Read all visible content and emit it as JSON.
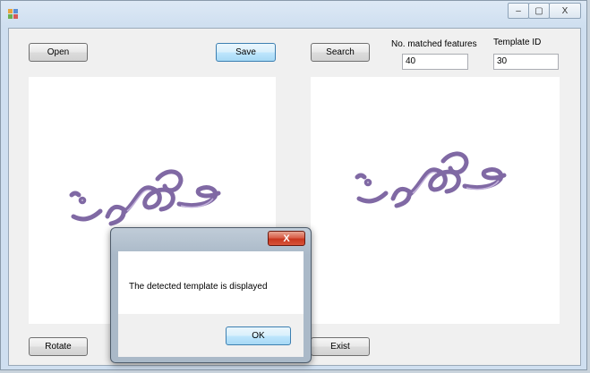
{
  "toolbar": {
    "open_label": "Open",
    "save_label": "Save",
    "search_label": "Search",
    "rotate_label": "Rotate",
    "exist_label": "Exist"
  },
  "fields": {
    "matched_label": "No. matched features",
    "matched_value": "40",
    "template_label": "Template ID",
    "template_value": "30"
  },
  "images": {
    "left_signature": "عکود",
    "right_signature": "عکود"
  },
  "dialog": {
    "message": "The detected template is displayed",
    "ok_label": "OK",
    "close_glyph": "X"
  },
  "window_controls": {
    "minimize_glyph": "–",
    "maximize_glyph": "▢",
    "close_glyph": "X"
  },
  "colors": {
    "signature_stroke": "#6a4f95",
    "dialog_close": "#c8371f"
  }
}
